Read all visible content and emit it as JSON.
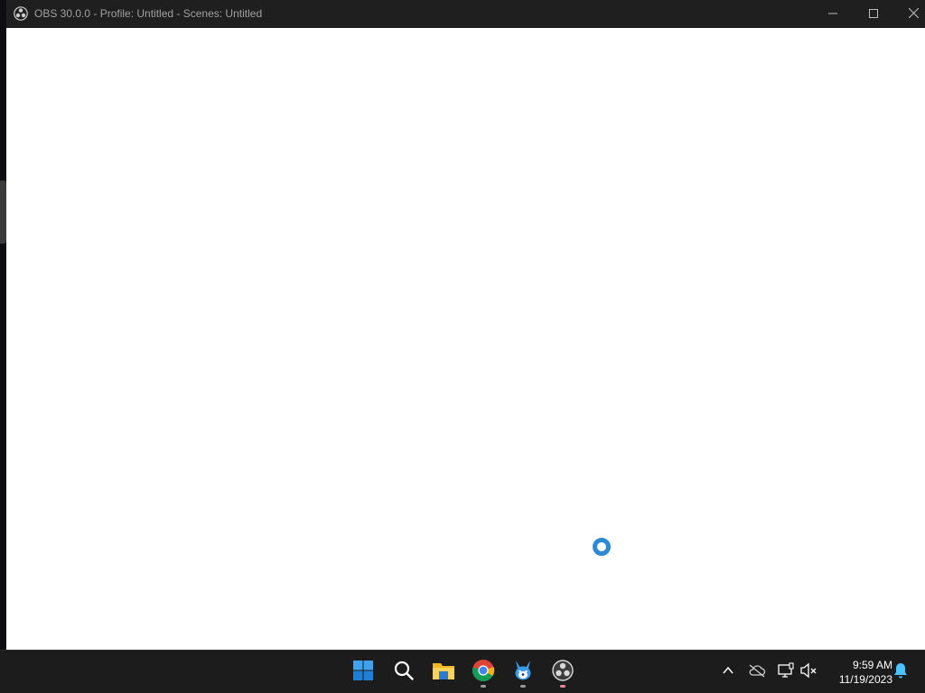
{
  "window": {
    "title": "OBS 30.0.0 - Profile: Untitled - Scenes: Untitled",
    "app_icon": "obs-logo-icon",
    "controls": [
      "minimize-icon",
      "maximize-icon",
      "close-icon"
    ]
  },
  "content": {
    "state": "loading",
    "spinner_icon": "loading-spinner-icon",
    "accent_color": "#2f8ad5"
  },
  "taskbar": {
    "apps": [
      {
        "name": "Start",
        "icon": "windows-start-icon",
        "running": false
      },
      {
        "name": "Search",
        "icon": "search-icon",
        "running": false
      },
      {
        "name": "File Explorer",
        "icon": "folder-icon",
        "running": false
      },
      {
        "name": "Google Chrome",
        "icon": "chrome-icon",
        "running": true
      },
      {
        "name": "App",
        "icon": "rabbit-app-icon",
        "running": true
      },
      {
        "name": "OBS Studio",
        "icon": "obs-icon",
        "running": true
      }
    ],
    "tray": {
      "icons": [
        "chevron-up-icon",
        "cloud-offline-icon",
        "display-network-icon",
        "speaker-muted-icon"
      ],
      "time": "9:59 AM",
      "date": "11/19/2023",
      "notification_icon": "bell-icon"
    }
  }
}
